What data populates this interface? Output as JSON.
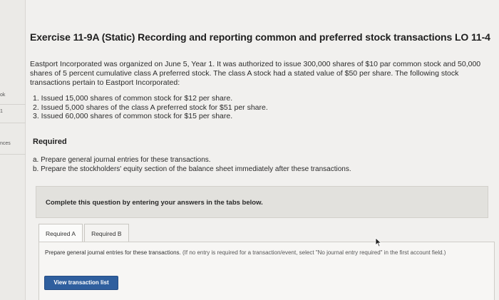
{
  "sidebar": {
    "labels": [
      "ok",
      "1",
      "nces"
    ]
  },
  "exercise": {
    "title": "Exercise 11-9A (Static) Recording and reporting common and preferred stock transactions LO 11-4",
    "intro": "Eastport Incorporated was organized on June 5, Year 1. It was authorized to issue 300,000 shares of $10 par common stock and 50,000 shares of 5 percent cumulative class A preferred stock. The class A stock had a stated value of $50 per share. The following stock transactions pertain to Eastport Incorporated:",
    "steps": [
      "1. Issued 15,000 shares of common stock for $12 per share.",
      "2. Issued 5,000 shares of the class A preferred stock for $51 per share.",
      "3. Issued 60,000 shares of common stock for $15 per share."
    ]
  },
  "required": {
    "heading": "Required",
    "items": [
      "a. Prepare general journal entries for these transactions.",
      "b. Prepare the stockholders' equity section of the balance sheet immediately after these transactions."
    ]
  },
  "complete_banner": "Complete this question by entering your answers in the tabs below.",
  "tabs": [
    {
      "label": "Required A",
      "active": true
    },
    {
      "label": "Required B",
      "active": false
    }
  ],
  "panel": {
    "instruction": "Prepare general journal entries for these transactions.",
    "note": "(If no entry is required for a transaction/event, select \"No journal entry required\" in the first account field.)",
    "view_button": "View transaction list"
  },
  "colors": {
    "background": "#f1f0ee",
    "button": "#2f5f9e",
    "banner": "#e2e1dd"
  }
}
